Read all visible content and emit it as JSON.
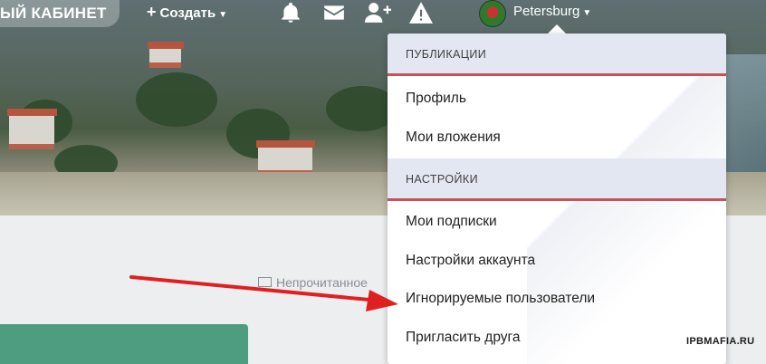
{
  "nav": {
    "cabinet_label": "ЫЙ КАБИНЕТ",
    "create_label": "Создать",
    "user_name": "Petersburg",
    "icons": [
      "bell-icon",
      "envelope-icon",
      "add-user-icon",
      "warning-icon"
    ]
  },
  "menu": {
    "sections": [
      {
        "title": "ПУБЛИКАЦИИ",
        "items": [
          "Профиль",
          "Мои вложения"
        ]
      },
      {
        "title": "НАСТРОЙКИ",
        "items": [
          "Мои подписки",
          "Настройки аккаунта",
          "Игнорируемые пользователи",
          "Пригласить друга"
        ]
      }
    ]
  },
  "content": {
    "unread_label": "Непрочитанное"
  },
  "annotation": {
    "arrow_color": "#e02020",
    "target_item": "Игнорируемые пользователи"
  },
  "watermark": "IPBMAFIA.RU",
  "colors": {
    "section_bg": "#e3e7f1",
    "section_border": "#c9515a",
    "green_block": "#4f9d81"
  }
}
